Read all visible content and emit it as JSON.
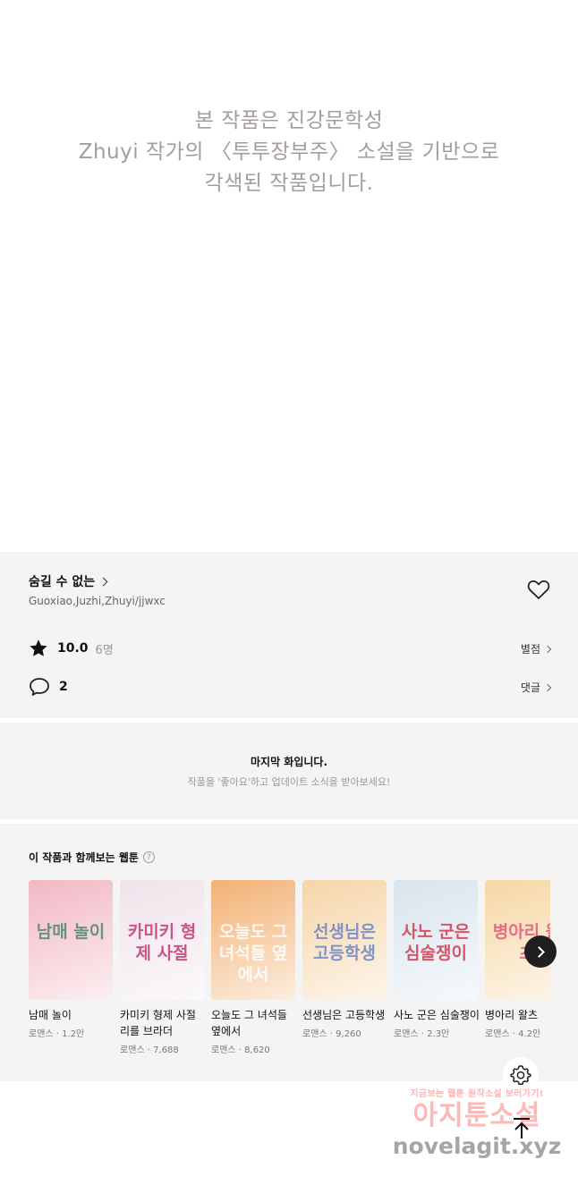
{
  "notice": {
    "lines": [
      "본 작품은 진강문학성",
      "Zhuyi 작가의 〈투투장부주〉 소설을 기반으로",
      "각색된 작품입니다."
    ]
  },
  "series": {
    "title": "숨길 수 없는",
    "authors": "Guoxiao,Juzhi,Zhuyi/jjwxc",
    "rating": "10.0",
    "rating_count": "6명",
    "rating_link": "별점",
    "comment_count": "2",
    "comment_link": "댓글"
  },
  "last_episode": {
    "title": "마지막 화입니다.",
    "subtitle": "작품을 '좋아요'하고 업데이트 소식을 받아보세요!"
  },
  "recommendations": {
    "header": "이 작품과 함께보는 웹툰",
    "help": "?",
    "items": [
      {
        "title": "남매 놀이",
        "genre": "로맨스",
        "views": "1.2만",
        "cover_text": "남매 놀이",
        "cover_color": "#f2b8c4",
        "text_color": "#4f8a6e"
      },
      {
        "title": "카미키 형제 사절 리를 브라더",
        "genre": "로맨스",
        "views": "7,688",
        "cover_text": "카미키 형제 사절",
        "cover_color": "#efe3ea",
        "text_color": "#c23a74"
      },
      {
        "title": "오늘도 그 녀석들 옆에서",
        "genre": "로맨스",
        "views": "8,620",
        "cover_text": "오늘도 그 녀석들 옆에서",
        "cover_color": "#f2b173",
        "text_color": "#ffffff"
      },
      {
        "title": "선생님은 고등학생",
        "genre": "로맨스",
        "views": "9,260",
        "cover_text": "선생님은 고등학생",
        "cover_color": "#f6d5a8",
        "text_color": "#6c86c4"
      },
      {
        "title": "사노 군은 심술쟁이",
        "genre": "로맨스",
        "views": "2.3만",
        "cover_text": "사노 군은 심술쟁이",
        "cover_color": "#d9e4ee",
        "text_color": "#d13b4f"
      },
      {
        "title": "병아리 왈츠",
        "genre": "로맨스",
        "views": "4.2만",
        "cover_text": "병아리 왈츠",
        "cover_color": "#f6d7a3",
        "text_color": "#e2577d"
      }
    ]
  },
  "watermark": {
    "line1": "지금보는 웹툰 원작소설 보러가기!",
    "line2": "아지툰소설",
    "line3": "novelagit.xyz"
  },
  "colors": {
    "panel_bg": "#f4f4f4",
    "notice_text": "#a39d9e",
    "next_button": "#1f1f1f"
  }
}
